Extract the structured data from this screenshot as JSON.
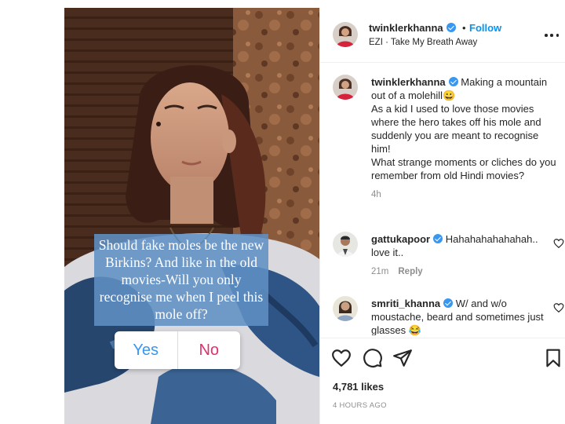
{
  "post": {
    "poll": {
      "question": "Should fake moles be the new Birkins? And like in the old movies-Will you only recognise me when I peel this mole off?",
      "option_yes": "Yes",
      "option_no": "No"
    }
  },
  "header": {
    "username": "twinklerkhanna",
    "separator": "•",
    "follow_label": "Follow",
    "audio": "EZI · Take My Breath Away"
  },
  "caption": {
    "username": "twinklerkhanna",
    "lines": [
      "Making a mountain out of a molehill😀",
      "As a kid I used to love those movies where the hero takes off his mole and suddenly you are meant to recognise him!",
      "What strange moments or cliches do you remember from old Hindi movies?"
    ],
    "time": "4h"
  },
  "comments": [
    {
      "username": "gattukapoor",
      "text": "Hahahahahahahah.. love it..",
      "time": "21m",
      "reply_label": "Reply"
    },
    {
      "username": "smriti_khanna",
      "text": "W/ and w/o moustache, beard and sometimes just glasses 😂"
    }
  ],
  "stats": {
    "likes": "4,781 likes",
    "posted": "4 HOURS AGO"
  },
  "icons": {
    "like": "heart-icon",
    "comment": "comment-icon",
    "share": "send-icon",
    "save": "bookmark-icon",
    "more": "more-options-icon",
    "verified": "verified-badge-icon"
  },
  "colors": {
    "follow": "#0095f6",
    "verified": "#3897f0",
    "poll_yes": "#3897f0",
    "poll_no": "#e1306c",
    "poll_box": "#608fc4"
  }
}
